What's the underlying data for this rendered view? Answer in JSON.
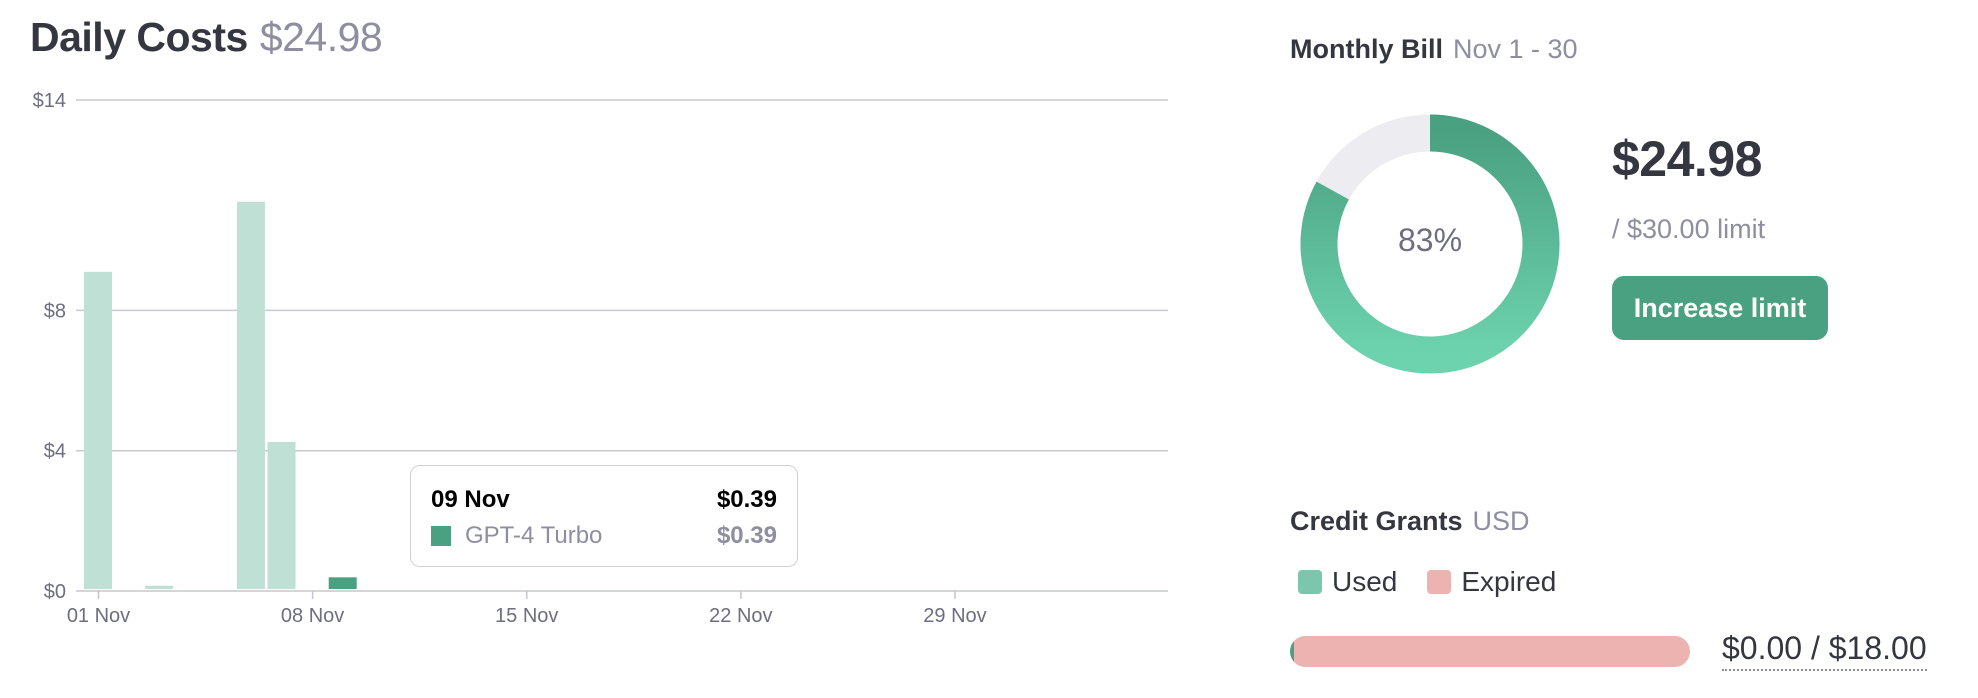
{
  "daily": {
    "title": "Daily Costs",
    "total": "$24.98"
  },
  "tooltip": {
    "date": "09 Nov",
    "total": "$0.39",
    "model": "GPT-4 Turbo",
    "amount": "$0.39"
  },
  "monthly": {
    "title": "Monthly Bill",
    "range": "Nov 1 - 30",
    "percent_label": "83%",
    "amount": "$24.98",
    "limit_label": "/ $30.00 limit",
    "button_label": "Increase limit"
  },
  "credit": {
    "title": "Credit Grants",
    "currency": "USD",
    "legend": [
      {
        "label": "Used",
        "color": "#7cc6ad"
      },
      {
        "label": "Expired",
        "color": "#ecb3b1"
      }
    ],
    "used_fraction": 0.01,
    "value_label": "$0.00 / $18.00"
  },
  "colors": {
    "bar_faded": "#bfe0d4",
    "bar_active": "#4aa181",
    "donut_track": "#ececf1",
    "donut_fill_start": "#4aa181",
    "donut_fill_end": "#6dd3af"
  },
  "chart_data": {
    "type": "bar",
    "title": "",
    "x": [
      1,
      2,
      3,
      4,
      5,
      6,
      7,
      8,
      9,
      10,
      11,
      12,
      13,
      14,
      15,
      16,
      17,
      18,
      19,
      20,
      21,
      22,
      23,
      24,
      25,
      26,
      27,
      28,
      29,
      30
    ],
    "values": [
      9.1,
      0,
      0.15,
      0,
      0,
      11.1,
      4.25,
      0,
      0.39,
      0,
      0,
      0,
      0,
      0,
      0,
      0,
      0,
      0,
      0,
      0,
      0,
      0,
      0,
      0,
      0,
      0,
      0,
      0,
      0,
      0
    ],
    "highlight_index": 8,
    "y_ticks": [
      {
        "value": 0,
        "label": "$0"
      },
      {
        "value": 4,
        "label": "$4"
      },
      {
        "value": 8,
        "label": "$8"
      },
      {
        "value": 14,
        "label": "$14"
      }
    ],
    "x_ticks": [
      {
        "day": 1,
        "label": "01 Nov"
      },
      {
        "day": 8,
        "label": "08 Nov"
      },
      {
        "day": 15,
        "label": "15 Nov"
      },
      {
        "day": 22,
        "label": "22 Nov"
      },
      {
        "day": 29,
        "label": "29 Nov"
      }
    ],
    "ylim": [
      0,
      14
    ],
    "grid": true
  }
}
